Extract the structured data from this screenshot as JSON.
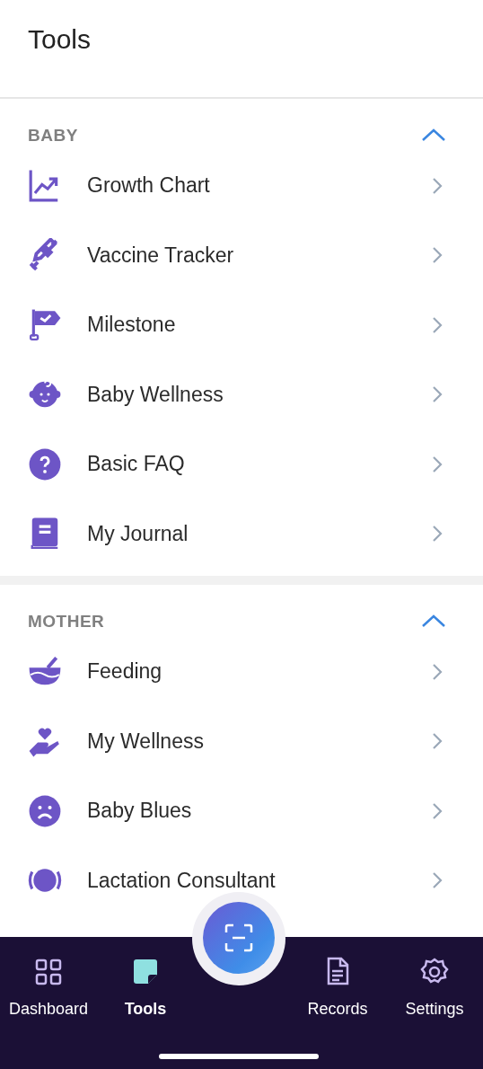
{
  "header": {
    "title": "Tools"
  },
  "sections": [
    {
      "title": "BABY",
      "expanded": true,
      "items": [
        {
          "label": "Growth Chart"
        },
        {
          "label": "Vaccine Tracker"
        },
        {
          "label": "Milestone"
        },
        {
          "label": "Baby Wellness"
        },
        {
          "label": "Basic FAQ"
        },
        {
          "label": "My Journal"
        }
      ]
    },
    {
      "title": "MOTHER",
      "expanded": true,
      "items": [
        {
          "label": "Feeding"
        },
        {
          "label": "My Wellness"
        },
        {
          "label": "Baby Blues"
        },
        {
          "label": "Lactation Consultant"
        }
      ]
    }
  ],
  "nav": [
    {
      "label": "Dashboard",
      "selected": false
    },
    {
      "label": "Tools",
      "selected": true
    },
    {
      "label": "Records",
      "selected": false
    },
    {
      "label": "Settings",
      "selected": false
    }
  ]
}
